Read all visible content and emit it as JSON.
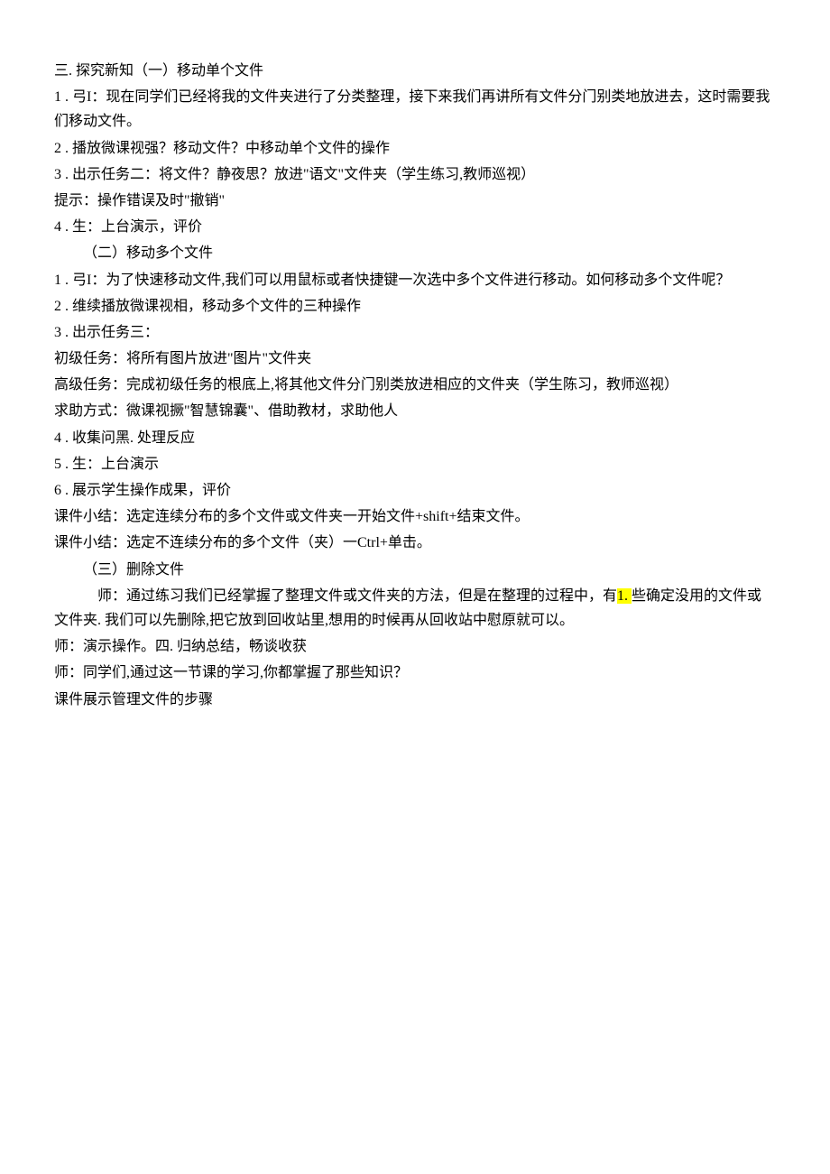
{
  "lines": {
    "l1": "三. 探究新知（一）移动单个文件",
    "l2": "1   . 弓I：现在同学们已经将我的文件夹进行了分类整理，接下来我们再讲所有文件分门别类地放进去，这时需要我们移动文件。",
    "l3": "2  . 播放微课视强？移动文件？中移动单个文件的操作",
    "l4": "3  . 出示任务二：将文件？静夜思？放进\"语文\"文件夹（学生练习,教师巡视）",
    "l5": "提示：操作错误及时\"撤销\"",
    "l6": "4   . 生：上台演示，评价",
    "l7": "（二）移动多个文件",
    "l8": "1   . 弓I：为了快速移动文件,我们可以用鼠标或者快捷键一次选中多个文件进行移动。如何移动多个文件呢？",
    "l9": "2  . 维续播放微课视相，移动多个文件的三种操作",
    "l10": "3  . 出示任务三：",
    "l11": "初级任务：将所有图片放进\"图片\"文件夹",
    "l12": "高级任务：完成初级任务的根底上,将其他文件分门别类放进相应的文件夹（学生陈习，教师巡视）",
    "l13": "求助方式：微课视撅\"智慧锦囊\"、借助教材，求助他人",
    "l14": "4   . 收集问黑. 处理反应",
    "l15": "5   . 生：上台演示",
    "l16": "6  . 展示学生操作成果，评价",
    "l17": "课件小结：选定连续分布的多个文件或文件夹一开始文件+shift+结束文件。",
    "l18": "课件小结：选定不连续分布的多个文件（夹）一Ctrl+单击。",
    "l19": "（三）删除文件",
    "l20a": "师：通过练习我们已经掌握了整理文件或文件夹的方法，但是在整理的过程中，有",
    "l20b": "1. ",
    "l20c": "些确定没用的文件或文件夹. 我们可以先删除,把它放到回收站里,想用的时候再从回收站中慰原就可以。",
    "l21": "师：演示操作。四. 归纳总结，畅谈收获",
    "l22": "师：同学们,通过这一节课的学习,你都掌握了那些知识？",
    "l23": "课件展示管理文件的步骤"
  }
}
